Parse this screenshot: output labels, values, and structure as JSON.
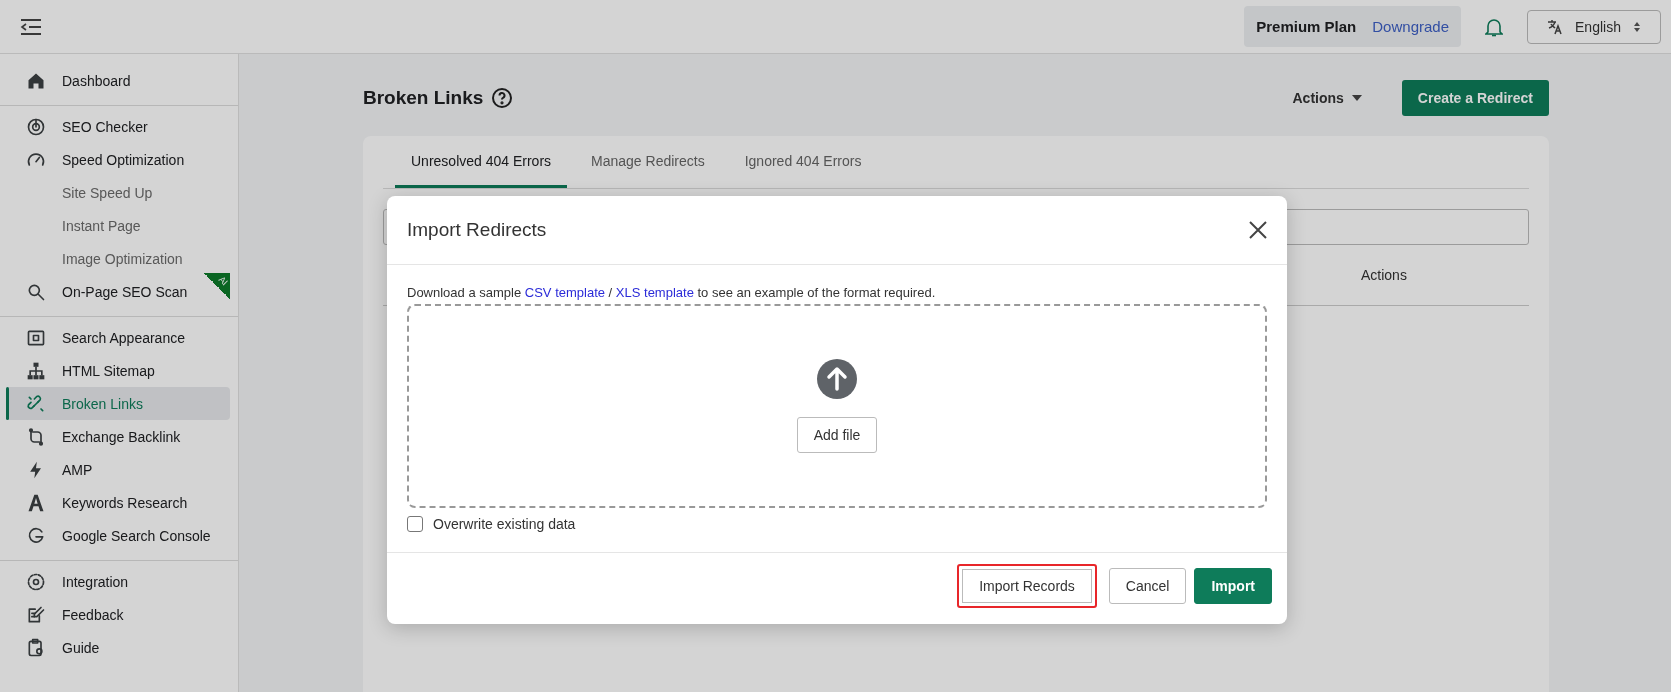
{
  "header": {
    "plan": "Premium Plan",
    "downgrade": "Downgrade",
    "language": "English"
  },
  "sidebar": {
    "groups": [
      {
        "items": [
          {
            "label": "Dashboard",
            "selected": false
          }
        ]
      },
      {
        "items": [
          {
            "label": "SEO Checker",
            "selected": false
          },
          {
            "label": "Speed Optimization",
            "selected": false,
            "children": [
              {
                "label": "Site Speed Up",
                "selected": false
              },
              {
                "label": "Instant Page",
                "selected": false
              },
              {
                "label": "Image Optimization",
                "selected": false
              }
            ]
          },
          {
            "label": "On-Page SEO Scan",
            "selected": false,
            "badge": "AI"
          }
        ]
      },
      {
        "items": [
          {
            "label": "Search Appearance",
            "selected": false
          },
          {
            "label": "HTML Sitemap",
            "selected": false
          },
          {
            "label": "Broken Links",
            "selected": true
          },
          {
            "label": "Exchange Backlink",
            "selected": false
          },
          {
            "label": "AMP",
            "selected": false
          },
          {
            "label": "Keywords Research",
            "selected": false
          },
          {
            "label": "Google Search Console",
            "selected": false
          }
        ]
      },
      {
        "items": [
          {
            "label": "Integration",
            "selected": false
          },
          {
            "label": "Feedback",
            "selected": false
          },
          {
            "label": "Guide",
            "selected": false
          }
        ]
      }
    ]
  },
  "page": {
    "title": "Broken Links",
    "actions": "Actions",
    "create_button": "Create a Redirect",
    "tabs": [
      {
        "label": "Unresolved 404 Errors",
        "selected": true
      },
      {
        "label": "Manage Redirects",
        "selected": false
      },
      {
        "label": "Ignored 404 Errors",
        "selected": false
      }
    ],
    "table": {
      "columns": [
        "Actions"
      ]
    }
  },
  "modal": {
    "title": "Import Redirects",
    "intro": {
      "before": "Download a sample ",
      "link_1": "CSV template",
      "separator": " / ",
      "link_2": "XLS template",
      "after": " to see an example of the format required."
    },
    "add_file": "Add file",
    "overwrite": {
      "label": "Overwrite existing data",
      "checked": false
    },
    "buttons": [
      {
        "label": "Import Records",
        "kind": "secondary",
        "highlighted": true
      },
      {
        "label": "Cancel",
        "kind": "secondary",
        "highlighted": false
      },
      {
        "label": "Import",
        "kind": "primary",
        "highlighted": false
      }
    ]
  }
}
